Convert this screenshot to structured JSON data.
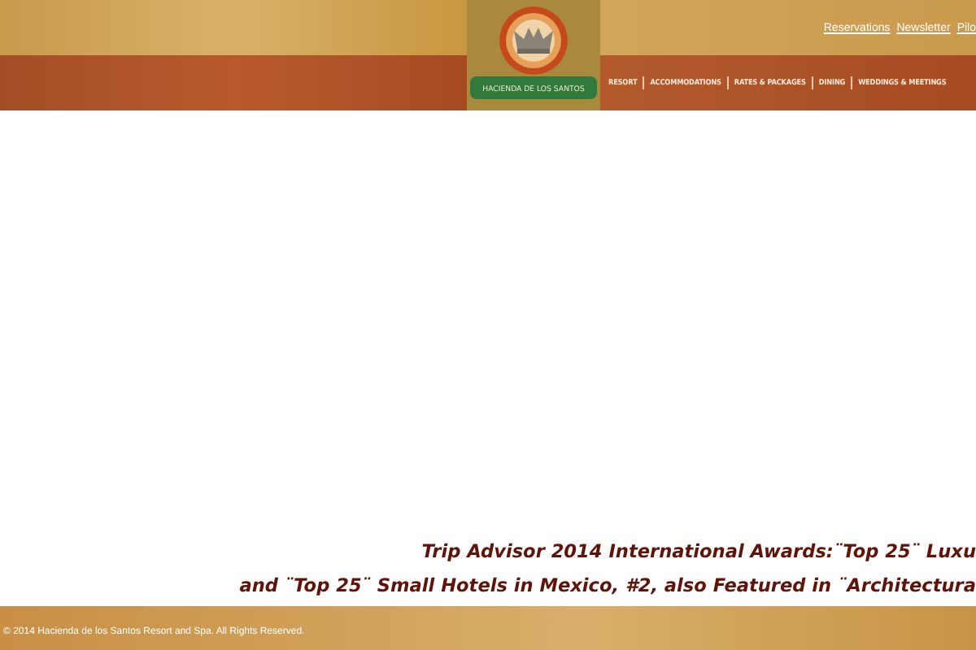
{
  "header": {
    "logo_text": "HACIENDA DE LOS SANTOS",
    "top_links": [
      "Reservations",
      "Newsletter",
      "Pilo"
    ],
    "nav": [
      "RESORT",
      "ACCOMMODATIONS",
      "RATES & PACKAGES",
      "DINING",
      "WEDDINGS & MEETINGS"
    ]
  },
  "awards": [
    "Trip Advisor 2014 International Awards:¨Top 25¨ Luxu",
    "and ¨Top 25¨ Small Hotels in Mexico, #2, also Featured in ¨Architectura"
  ],
  "footer": {
    "copyright": "© 2014 Hacienda de los Santos Resort and Spa. All Rights Reserved."
  }
}
